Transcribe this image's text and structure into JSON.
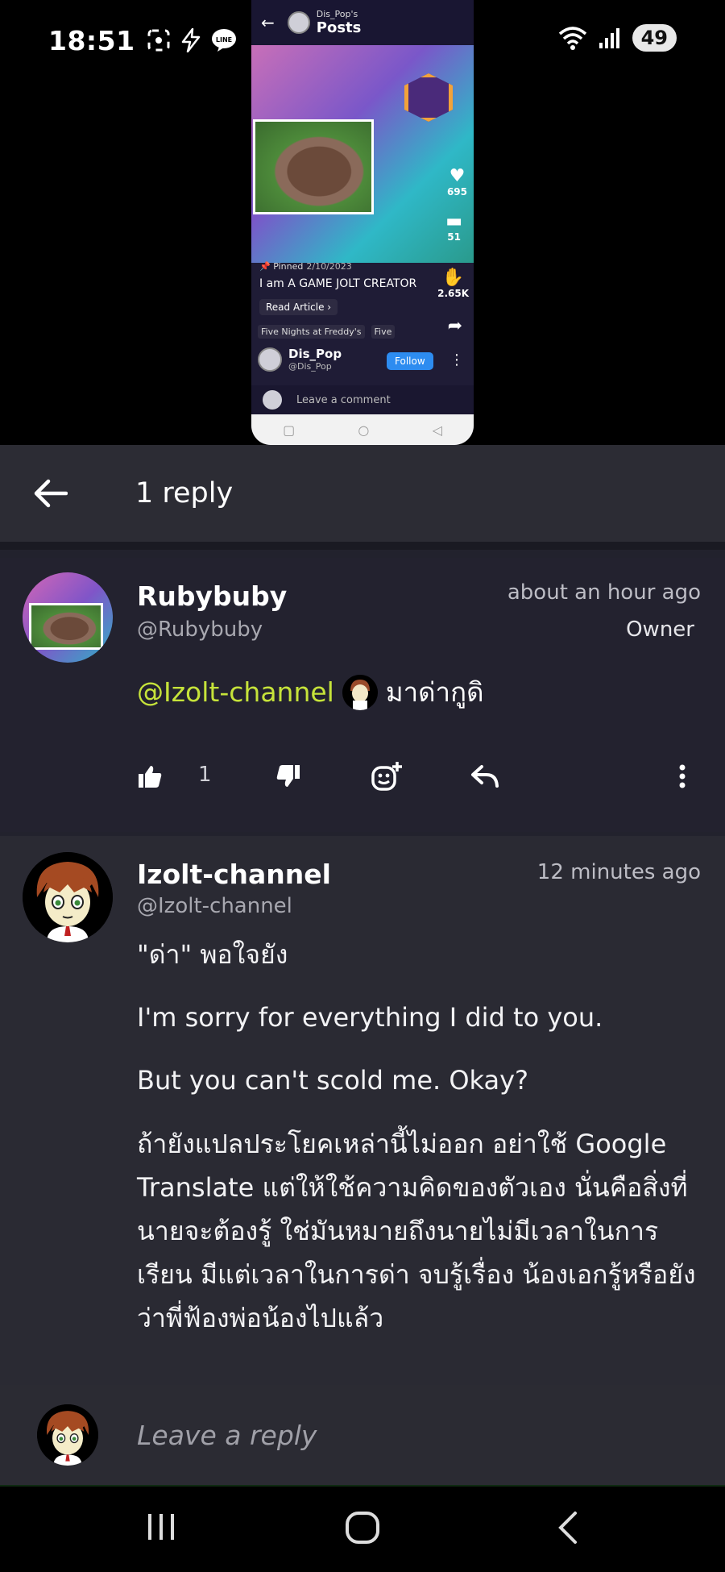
{
  "status_bar": {
    "time": "18:51",
    "battery": "49",
    "icons": [
      "screenshot-icon",
      "bolt-icon",
      "line-icon",
      "dot-icon",
      "wifi-icon",
      "signal-icon"
    ]
  },
  "video": {
    "channel": "Dis_Pop's",
    "title": "Posts",
    "likes": "695",
    "comments": "51",
    "dislikes": "2.65K",
    "pinned_label": "Pinned",
    "pinned_date": "2/10/2023",
    "post_title": "I am A GAME JOLT CREATOR",
    "read_article": "Read Article ›",
    "tags": [
      "Five Nights at Freddy's",
      "Five"
    ],
    "author_name": "Dis_Pop",
    "author_handle": "@Dis_Pop",
    "follow_label": "Follow",
    "comment_placeholder": "Leave a comment"
  },
  "header": {
    "title": "1 reply"
  },
  "parent_comment": {
    "author": "Rubybuby",
    "handle": "@Rubybuby",
    "time": "about an hour ago",
    "badge": "Owner",
    "mention": "@Izolt-channel",
    "text": "มาด่ากูดิ",
    "like_count": "1"
  },
  "reply_comment": {
    "author": "Izolt-channel",
    "handle": "@Izolt-channel",
    "time": "12 minutes ago",
    "paragraphs": [
      "\"ด่า\" พอใจยัง",
      "I'm sorry for everything I did to you.",
      "But you can't scold me. Okay?",
      "ถ้ายังแปลประโยคเหล่านี้ไม่ออก อย่าใช้ Google Translate แต่ให้ใช้ความคิดของตัวเอง นั่นคือสิ่งที่นายจะต้องรู้ ใช่มันหมายถึงนายไม่มีเวลาในการเรียน มีแต่เวลาในการด่า จบรู้เรื่อง น้องเอกรู้หรือยังว่าพี่ฟ้องพ่อน้องไปแล้ว"
    ]
  },
  "reply_bar": {
    "placeholder": "Leave a reply"
  },
  "colors": {
    "mention": "#c6e33a",
    "panel_bg": "#22222d",
    "follow": "#2d8cf0"
  }
}
